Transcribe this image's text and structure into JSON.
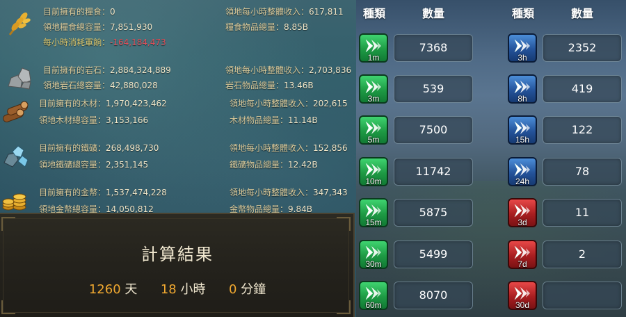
{
  "resources": {
    "food": {
      "icon": "wheat-icon",
      "owned_label": "目前擁有的糧食：",
      "owned": "0",
      "income_label": "領地每小時整體收入：",
      "income": "617,811",
      "capacity_label": "領地糧食總容量：",
      "capacity": "7,851,930",
      "items_label": "糧食物品總量：",
      "items": "8.85B",
      "upkeep_label": "每小時消耗軍餉：",
      "upkeep": "-164,184,473"
    },
    "stone": {
      "icon": "stone-icon",
      "owned_label": "目前擁有的岩石：",
      "owned": "2,884,324,889",
      "income_label": "領地每小時整體收入：",
      "income": "2,703,836",
      "capacity_label": "領地岩石總容量：",
      "capacity": "42,880,028",
      "items_label": "岩石物品總量：",
      "items": "13.46B"
    },
    "wood": {
      "icon": "wood-icon",
      "owned_label": "目前擁有的木材：",
      "owned": "1,970,423,462",
      "income_label": "領地每小時整體收入：",
      "income": "202,615",
      "capacity_label": "領地木材總容量：",
      "capacity": "3,153,166",
      "items_label": "木材物品總量：",
      "items": "11.14B"
    },
    "ore": {
      "icon": "ore-icon",
      "owned_label": "目前擁有的鐵礦：",
      "owned": "268,498,730",
      "income_label": "領地每小時整體收入：",
      "income": "152,856",
      "capacity_label": "領地鐵礦總容量：",
      "capacity": "2,351,145",
      "items_label": "鐵礦物品總量：",
      "items": "12.42B"
    },
    "gold": {
      "icon": "gold-coins-icon",
      "owned_label": "目前擁有的金幣：",
      "owned": "1,537,474,228",
      "income_label": "領地每小時整體收入：",
      "income": "347,343",
      "capacity_label": "領地金幣總容量：",
      "capacity": "14,050,812",
      "items_label": "金幣物品總量：",
      "items": "9.84B"
    }
  },
  "calc": {
    "title": "計算結果",
    "days": "1260",
    "days_unit": "天",
    "hours": "18",
    "hours_unit": "小時",
    "minutes": "0",
    "minutes_unit": "分鐘"
  },
  "table": {
    "header_type": "種類",
    "header_qty": "數量",
    "left": [
      {
        "label": "1m",
        "qty": "7368",
        "color": "green"
      },
      {
        "label": "3m",
        "qty": "539",
        "color": "green"
      },
      {
        "label": "5m",
        "qty": "7500",
        "color": "green"
      },
      {
        "label": "10m",
        "qty": "11742",
        "color": "green"
      },
      {
        "label": "15m",
        "qty": "5875",
        "color": "green"
      },
      {
        "label": "30m",
        "qty": "5499",
        "color": "green"
      },
      {
        "label": "60m",
        "qty": "8070",
        "color": "green"
      }
    ],
    "right": [
      {
        "label": "3h",
        "qty": "2352",
        "color": "blue"
      },
      {
        "label": "8h",
        "qty": "419",
        "color": "blue"
      },
      {
        "label": "15h",
        "qty": "122",
        "color": "blue"
      },
      {
        "label": "24h",
        "qty": "78",
        "color": "blue"
      },
      {
        "label": "3d",
        "qty": "11",
        "color": "red"
      },
      {
        "label": "7d",
        "qty": "2",
        "color": "red"
      },
      {
        "label": "30d",
        "qty": "",
        "color": "red"
      }
    ],
    "item_icon": "speedup-arrows-icon"
  }
}
